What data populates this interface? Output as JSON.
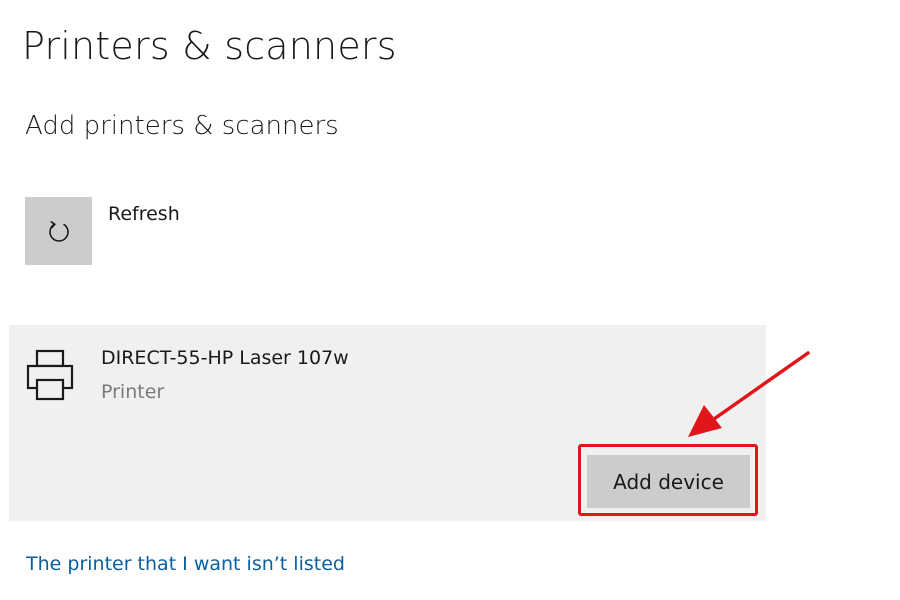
{
  "header": {
    "title": "Printers & scanners"
  },
  "section": {
    "title": "Add printers & scanners"
  },
  "refresh": {
    "label": "Refresh",
    "icon": "refresh-icon"
  },
  "device": {
    "name": "DIRECT-55-HP Laser 107w",
    "type": "Printer",
    "icon": "printer-icon",
    "add_button_label": "Add device"
  },
  "link": {
    "label": "The printer that I want isn’t listed"
  },
  "colors": {
    "accent_link": "#0a5f9e",
    "highlight": "#e0161b",
    "button_bg": "#cccccc",
    "card_bg": "#f0f0f0"
  }
}
